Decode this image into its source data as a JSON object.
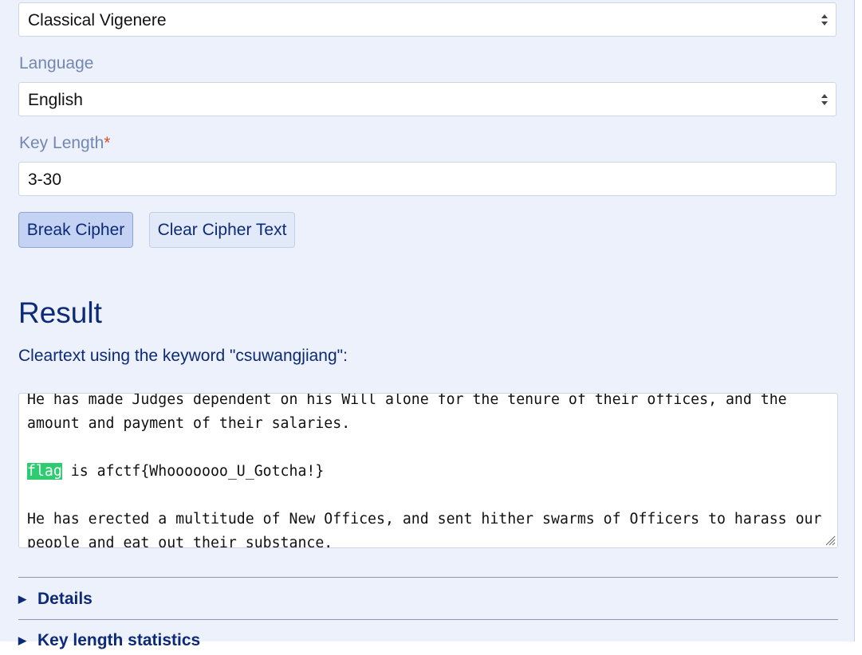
{
  "cipher_select": {
    "value": "Classical Vigenere"
  },
  "language": {
    "label": "Language",
    "value": "English"
  },
  "key_length": {
    "label": "Key Length",
    "required_mark": "*",
    "value": "3-30"
  },
  "buttons": {
    "break": "Break Cipher",
    "clear": "Clear Cipher Text"
  },
  "result": {
    "title": "Result",
    "cleartext_label": "Cleartext using the keyword \"csuwangjiang\":",
    "lines": {
      "l1": "He has made Judges dependent on his Will alone for the tenure of their offices, and the",
      "l2": "amount and payment of their salaries.",
      "flag_word": "flag",
      "flag_rest": " is afctf{Whooooooo_U_Gotcha!}",
      "l5": "He has erected a multitude of New Offices, and sent hither swarms of Officers to harass our",
      "l6": "people and eat out their substance."
    }
  },
  "sections": {
    "details": "Details",
    "key_stats": "Key length statistics"
  },
  "icons": {
    "select_arrows": "updown-arrows-icon",
    "disclosure": "triangle-right-icon",
    "resize": "resize-grip-icon"
  }
}
